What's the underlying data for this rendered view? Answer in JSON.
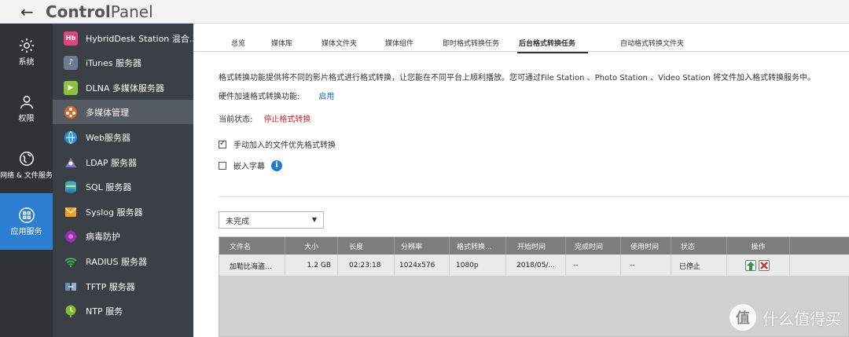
{
  "titlebar": {
    "title_bold": "Control",
    "title_rest": "Panel"
  },
  "categories": [
    {
      "label": "系统",
      "icon": "gear-icon"
    },
    {
      "label": "权限",
      "icon": "user-icon"
    },
    {
      "label": "网络 & 文件服务",
      "icon": "globe-icon"
    },
    {
      "label": "应用服务",
      "icon": "apps-icon"
    }
  ],
  "sidebar": {
    "items": [
      {
        "label": "HybridDesk Station 混合...",
        "icon": "hybriddesk-icon",
        "color": "#e0457b"
      },
      {
        "label": "iTunes 服务器",
        "icon": "itunes-icon",
        "color": "#6a7b92"
      },
      {
        "label": "DLNA 多媒体服务器",
        "icon": "dlna-icon",
        "color": "#8fbf3f"
      },
      {
        "label": "多媒体管理",
        "icon": "media-icon",
        "color": "#e0662a"
      },
      {
        "label": "Web服务器",
        "icon": "web-icon",
        "color": "#2a8fd8"
      },
      {
        "label": "LDAP 服务器",
        "icon": "ldap-icon",
        "color": "#8a6fcf"
      },
      {
        "label": "SQL 服务器",
        "icon": "sql-icon",
        "color": "#3fa9c9"
      },
      {
        "label": "Syslog 服务器",
        "icon": "syslog-icon",
        "color": "#f0a020"
      },
      {
        "label": "病毒防护",
        "icon": "antivirus-icon",
        "color": "#9a2fb0"
      },
      {
        "label": "RADIUS 服务器",
        "icon": "radius-icon",
        "color": "#3fbf4f"
      },
      {
        "label": "TFTP 服务器",
        "icon": "tftp-icon",
        "color": "#6a8fb0"
      },
      {
        "label": "NTP 服务",
        "icon": "ntp-icon",
        "color": "#7fbf2f"
      }
    ]
  },
  "tabs": [
    "总览",
    "媒体库",
    "媒体文件夹",
    "媒体组件",
    "即时格式转换任务",
    "后台格式转换任务",
    "自动格式转换文件夹"
  ],
  "main": {
    "description": "格式转换功能提供将不同的影片格式进行格式转换，让您能在不同平台上顺利播放。您可通过File Station 、Photo Station 、Video Station 将文件加入格式转换服务中。",
    "hw_label": "硬件加速格式转换功能:",
    "hw_value": "启用",
    "status_label": "当前状态:",
    "status_value": "停止格式转换",
    "opt1": "手动加入的文件优先格式转换",
    "opt2": "嵌入字幕",
    "filter": "未完成"
  },
  "table": {
    "headers": [
      "文件名",
      "大小",
      "长度",
      "分辨率",
      "格式转换...",
      "开始时间",
      "完成时间",
      "使用时间",
      "状态",
      "操作"
    ],
    "rows": [
      [
        "加勒比海盗...",
        "1.2 GB",
        "02:23:18",
        "1024x576",
        "1080p",
        "2018/05/...",
        "--",
        "--",
        "已停止"
      ]
    ]
  },
  "watermark": {
    "text": "什么值得买",
    "logo": "值"
  }
}
